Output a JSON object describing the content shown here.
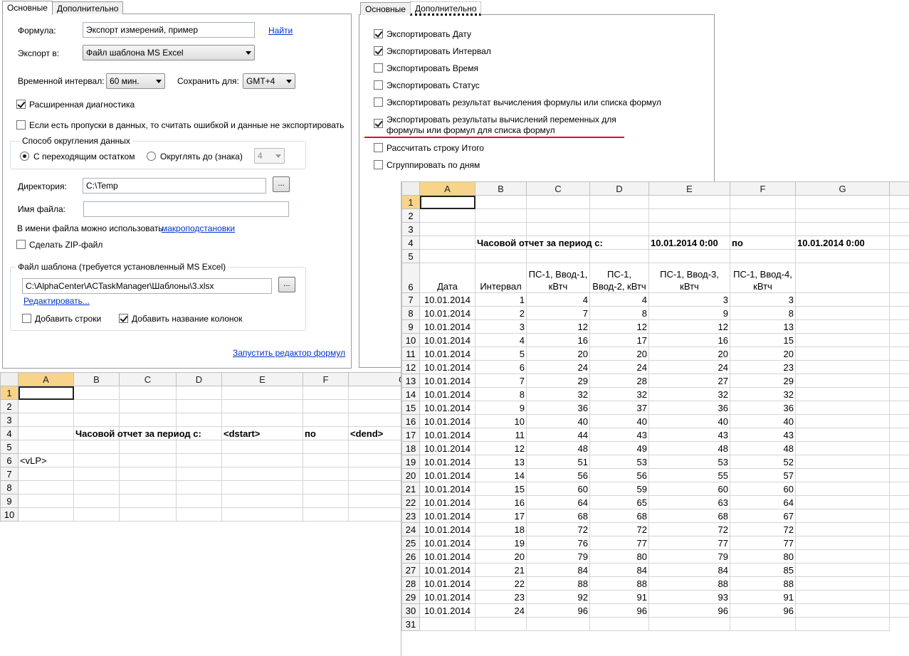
{
  "left_dialog": {
    "tabs": [
      "Основные",
      "Дополнительно"
    ],
    "formula_label": "Формула:",
    "formula_value": "Экспорт измерений, пример",
    "find_link": "Найти",
    "export_label": "Экспорт в:",
    "export_value": "Файл шаблона MS Excel",
    "interval_label": "Временной интервал:",
    "interval_value": "60 мин.",
    "save_for_label": "Сохранить для:",
    "save_for_value": "GMT+4",
    "extended_diag": {
      "label": "Расширенная диагностика",
      "checked": true
    },
    "gaps_error": {
      "label": "Если есть пропуски в данных, то считать ошибкой и данные не экспортировать",
      "checked": false
    },
    "rounding_title": "Способ округления данных",
    "round_carry": {
      "label": "С переходящим остатком",
      "selected": true
    },
    "round_to": {
      "label": "Округлять до (знака)",
      "selected": false
    },
    "round_digits": "4",
    "dir_label": "Директория:",
    "dir_value": "C:\\Temp",
    "browse_label": "...",
    "filename_label": "Имя файла:",
    "filename_value": "",
    "macro_hint": "В имени файла можно использовать",
    "macro_link": "макроподстановки",
    "zip": {
      "label": "Сделать ZIP-файл",
      "checked": false
    },
    "template_title": "Файл шаблона (требуется установленный MS Excel)",
    "template_path": "C:\\AlphaCenter\\ACTaskManager\\Шаблоны\\3.xlsx",
    "edit_link": "Редактировать...",
    "add_rows": {
      "label": "Добавить строки",
      "checked": false
    },
    "add_col_names": {
      "label": "Добавить название колонок",
      "checked": true
    },
    "formula_editor_link": "Запустить редактор формул"
  },
  "right_dialog": {
    "tabs": [
      "Основные",
      "Дополнительно"
    ],
    "options": [
      {
        "label": "Экспортировать Дату",
        "checked": true
      },
      {
        "label": "Экспортировать Интервал",
        "checked": true
      },
      {
        "label": "Экспортировать Время",
        "checked": false
      },
      {
        "label": "Экспортировать Статус",
        "checked": false
      },
      {
        "label": "Экспортировать результат вычисления формулы или списка формул",
        "checked": false
      },
      {
        "label": "Экспортировать результаты вычислений переменных для",
        "label2": "формулы или формул для списка формул",
        "checked": true
      },
      {
        "label": "Рассчитать строку Итого",
        "checked": false
      },
      {
        "label": "Сгруппировать по дням",
        "checked": false
      }
    ],
    "highlight_color": "#e0101a"
  },
  "template_sheet": {
    "columns": [
      "A",
      "B",
      "C",
      "D",
      "E",
      "F",
      "G"
    ],
    "rows": [
      "1",
      "2",
      "3",
      "4",
      "5",
      "6",
      "7",
      "8",
      "9",
      "10"
    ],
    "row4": {
      "title": "Часовой отчет за период с:",
      "start": "<dstart>",
      "po": "по",
      "end": "<dend>"
    },
    "row6_a": "<vLP>"
  },
  "result_sheet": {
    "columns": [
      "A",
      "B",
      "C",
      "D",
      "E",
      "F",
      "G"
    ],
    "header_rows": [
      "1",
      "2",
      "3",
      "4",
      "5",
      "6"
    ],
    "row4": {
      "title": "Часовой отчет за период с:",
      "start": "10.01.2014 0:00",
      "po": "по",
      "end": "10.01.2014 0:00"
    },
    "col_headers": {
      "date": "Дата",
      "interval": "Интервал",
      "c": "ПС-1, Ввод-1, кВтч",
      "d": "ПС-1, Ввод-2, кВтч",
      "e": "ПС-1, Ввод-3, кВтч",
      "f": "ПС-1, Ввод-4, кВтч"
    },
    "data_rows": [
      {
        "row": "7",
        "date": "10.01.2014",
        "interval": "1",
        "c": "4",
        "d": "4",
        "e": "3",
        "f": "3"
      },
      {
        "row": "8",
        "date": "10.01.2014",
        "interval": "2",
        "c": "7",
        "d": "8",
        "e": "9",
        "f": "8"
      },
      {
        "row": "9",
        "date": "10.01.2014",
        "interval": "3",
        "c": "12",
        "d": "12",
        "e": "12",
        "f": "13"
      },
      {
        "row": "10",
        "date": "10.01.2014",
        "interval": "4",
        "c": "16",
        "d": "17",
        "e": "16",
        "f": "15"
      },
      {
        "row": "11",
        "date": "10.01.2014",
        "interval": "5",
        "c": "20",
        "d": "20",
        "e": "20",
        "f": "20"
      },
      {
        "row": "12",
        "date": "10.01.2014",
        "interval": "6",
        "c": "24",
        "d": "24",
        "e": "24",
        "f": "23"
      },
      {
        "row": "13",
        "date": "10.01.2014",
        "interval": "7",
        "c": "29",
        "d": "28",
        "e": "27",
        "f": "29"
      },
      {
        "row": "14",
        "date": "10.01.2014",
        "interval": "8",
        "c": "32",
        "d": "32",
        "e": "32",
        "f": "32"
      },
      {
        "row": "15",
        "date": "10.01.2014",
        "interval": "9",
        "c": "36",
        "d": "37",
        "e": "36",
        "f": "36"
      },
      {
        "row": "16",
        "date": "10.01.2014",
        "interval": "10",
        "c": "40",
        "d": "40",
        "e": "40",
        "f": "40"
      },
      {
        "row": "17",
        "date": "10.01.2014",
        "interval": "11",
        "c": "44",
        "d": "43",
        "e": "43",
        "f": "43"
      },
      {
        "row": "18",
        "date": "10.01.2014",
        "interval": "12",
        "c": "48",
        "d": "49",
        "e": "48",
        "f": "48"
      },
      {
        "row": "19",
        "date": "10.01.2014",
        "interval": "13",
        "c": "51",
        "d": "53",
        "e": "53",
        "f": "52"
      },
      {
        "row": "20",
        "date": "10.01.2014",
        "interval": "14",
        "c": "56",
        "d": "56",
        "e": "55",
        "f": "57"
      },
      {
        "row": "21",
        "date": "10.01.2014",
        "interval": "15",
        "c": "60",
        "d": "59",
        "e": "60",
        "f": "60"
      },
      {
        "row": "22",
        "date": "10.01.2014",
        "interval": "16",
        "c": "64",
        "d": "65",
        "e": "63",
        "f": "64"
      },
      {
        "row": "23",
        "date": "10.01.2014",
        "interval": "17",
        "c": "68",
        "d": "68",
        "e": "68",
        "f": "67"
      },
      {
        "row": "24",
        "date": "10.01.2014",
        "interval": "18",
        "c": "72",
        "d": "72",
        "e": "72",
        "f": "72"
      },
      {
        "row": "25",
        "date": "10.01.2014",
        "interval": "19",
        "c": "76",
        "d": "77",
        "e": "77",
        "f": "77"
      },
      {
        "row": "26",
        "date": "10.01.2014",
        "interval": "20",
        "c": "79",
        "d": "80",
        "e": "79",
        "f": "80"
      },
      {
        "row": "27",
        "date": "10.01.2014",
        "interval": "21",
        "c": "84",
        "d": "84",
        "e": "84",
        "f": "85"
      },
      {
        "row": "28",
        "date": "10.01.2014",
        "interval": "22",
        "c": "88",
        "d": "88",
        "e": "88",
        "f": "88"
      },
      {
        "row": "29",
        "date": "10.01.2014",
        "interval": "23",
        "c": "92",
        "d": "91",
        "e": "93",
        "f": "91"
      },
      {
        "row": "30",
        "date": "10.01.2014",
        "interval": "24",
        "c": "96",
        "d": "96",
        "e": "96",
        "f": "96"
      }
    ],
    "last_row": "31"
  }
}
